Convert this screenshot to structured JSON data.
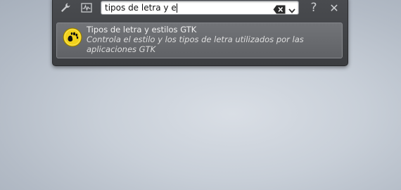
{
  "search": {
    "query": "tipos de letra y e",
    "typed_prefix": "tipos de letra y e"
  },
  "toolbar": {
    "config_icon": "wrench-icon",
    "activity_icon": "activity-monitor-icon",
    "help_label": "?",
    "close_label": "✕"
  },
  "results": [
    {
      "icon": "gnome-foot-icon",
      "title": "Tipos de letra y estilos GTK",
      "description": "Controla el estilo y los tipos de letra utilizados por las aplicaciones GTK"
    }
  ],
  "colors": {
    "panel": "#3f4144",
    "result_bg": "#6a6c70",
    "icon_yellow": "#f2d21b"
  }
}
